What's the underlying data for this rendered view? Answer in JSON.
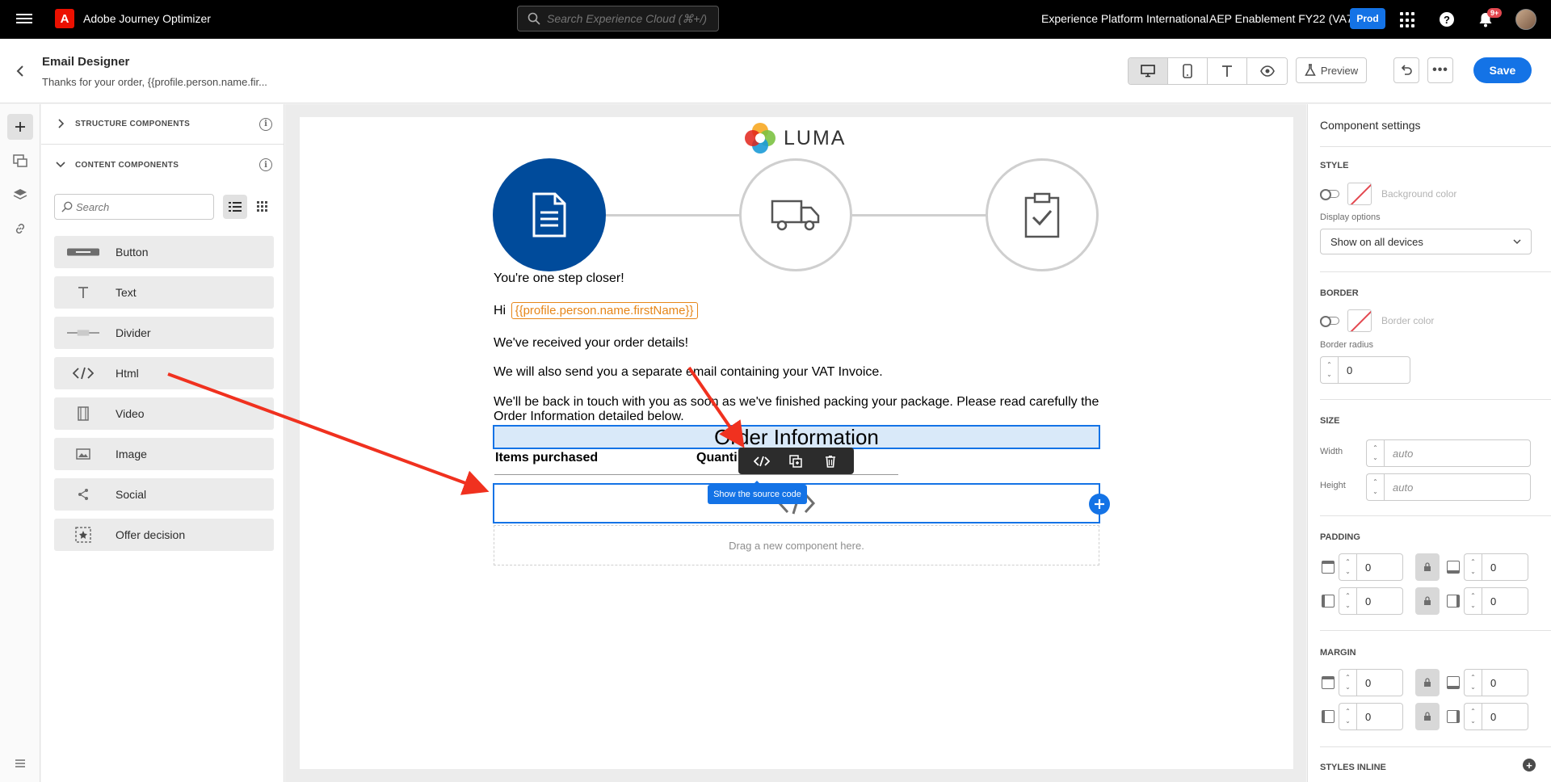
{
  "topbar": {
    "app_title": "Adobe Journey Optimizer",
    "search_placeholder": "Search Experience Cloud (⌘+/)",
    "org_name": "Experience Platform International",
    "sandbox_name": "AEP Enablement FY22 (VA7)",
    "env_badge": "Prod",
    "notification_count": "9+"
  },
  "header": {
    "title": "Email Designer",
    "subject": "Thanks for your order, {{profile.person.name.fir...",
    "preview_label": "Preview",
    "more_label": "•••",
    "save_label": "Save"
  },
  "components_panel": {
    "structure_label": "STRUCTURE COMPONENTS",
    "content_label": "CONTENT COMPONENTS",
    "search_placeholder": "Search",
    "items": [
      {
        "label": "Button",
        "icon": "button-icon"
      },
      {
        "label": "Text",
        "icon": "text-icon"
      },
      {
        "label": "Divider",
        "icon": "divider-icon"
      },
      {
        "label": "Html",
        "icon": "code-icon"
      },
      {
        "label": "Video",
        "icon": "video-icon"
      },
      {
        "label": "Image",
        "icon": "image-icon"
      },
      {
        "label": "Social",
        "icon": "share-icon"
      },
      {
        "label": "Offer decision",
        "icon": "offer-decision-icon"
      }
    ]
  },
  "email": {
    "brand": "LUMA",
    "line1": "You're one step closer!",
    "hi": "Hi",
    "first_name_token": "{{profile.person.name.firstName}}",
    "line2": "We've received your order details!",
    "line3": "We will also send you a separate email containing your VAT Invoice.",
    "line4a": "We'll be back in touch with you as soon as we've finished packing your package. Please read carefully the",
    "line4b": "Order Information detailed below.",
    "order_info_heading": "Order Information",
    "col_items": "Items purchased",
    "col_quantity": "Quanti",
    "tooltip": "Show the source code",
    "drop_zone": "Drag a new component here."
  },
  "settings": {
    "title": "Component settings",
    "style_label": "STYLE",
    "background_color_label": "Background color",
    "display_options_label": "Display options",
    "display_options_value": "Show on all devices",
    "border_label": "BORDER",
    "border_color_label": "Border color",
    "border_radius_label": "Border radius",
    "border_radius_value": "0",
    "size_label": "SIZE",
    "width_label": "Width",
    "width_placeholder": "auto",
    "height_label": "Height",
    "height_placeholder": "auto",
    "padding_label": "PADDING",
    "padding_top": "0",
    "padding_bottom": "0",
    "padding_left": "0",
    "padding_right": "0",
    "margin_label": "MARGIN",
    "margin_top": "0",
    "margin_bottom": "0",
    "margin_left": "0",
    "margin_right": "0",
    "styles_inline_label": "STYLES INLINE"
  },
  "colors": {
    "accent": "#1473e6",
    "annotation_arrow": "#f0311f",
    "step_active": "#004b9b",
    "token": "#e68619"
  }
}
